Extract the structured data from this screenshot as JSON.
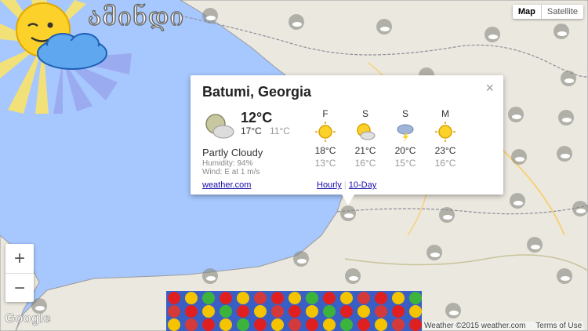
{
  "app": {
    "logo_title": "ამინდი"
  },
  "map_type": {
    "map_label": "Map",
    "satellite_label": "Satellite",
    "selected": "Map"
  },
  "zoom": {
    "plus": "+",
    "minus": "−"
  },
  "popup": {
    "city": "Batumi, Georgia",
    "close": "×",
    "current": {
      "temp": "12°C",
      "high": "17°C",
      "low": "11°C",
      "icon": "partly-cloudy-icon"
    },
    "condition": "Partly Cloudy",
    "humidity": "Humidity: 94%",
    "wind": "Wind: E at 1 m/s",
    "source_link": "weather.com",
    "forecast": [
      {
        "day": "F",
        "high": "18°C",
        "low": "13°C",
        "icon": "sunny-icon"
      },
      {
        "day": "S",
        "high": "21°C",
        "low": "16°C",
        "icon": "partly-cloudy-icon"
      },
      {
        "day": "S",
        "high": "20°C",
        "low": "15°C",
        "icon": "thunderstorm-icon"
      },
      {
        "day": "M",
        "high": "23°C",
        "low": "16°C",
        "icon": "sunny-icon"
      }
    ],
    "hourly_link": "Hourly",
    "separator": "|",
    "tenday_link": "10-Day"
  },
  "attribution": {
    "google": "Google",
    "weather": "Weather ©2015",
    "weather_link": "weather.com",
    "terms": "Terms of Use"
  },
  "colors": {
    "sea": "#a6c8ff",
    "land": "#ebe8e0",
    "link": "#1a0dab",
    "sun": "#fcd12a"
  }
}
